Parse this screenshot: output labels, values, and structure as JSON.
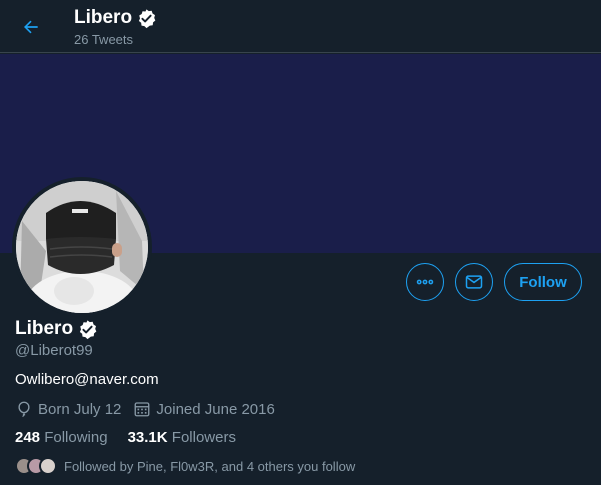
{
  "header": {
    "name": "Libero",
    "tweet_count": "26 Tweets"
  },
  "profile": {
    "display_name": "Libero",
    "handle": "@Liberot99",
    "bio": "Owlibero@naver.com",
    "birthday": "Born July 12",
    "joined": "Joined June 2016",
    "following_count": "248",
    "following_label": "Following",
    "followers_count": "33.1K",
    "followers_label": "Followers",
    "followed_by": "Followed by Pine, Fl0w3R, and 4 others you follow"
  },
  "actions": {
    "follow_label": "Follow"
  },
  "icons": {
    "back": "arrow-left-icon",
    "verified": "verified-badge-icon",
    "more": "more-icon",
    "message": "mail-icon",
    "birthday": "balloon-icon",
    "joined": "calendar-icon"
  },
  "colors": {
    "background": "#15202b",
    "banner": "#1a1e4a",
    "accent": "#1da1f2",
    "secondary_text": "#8899a6"
  }
}
